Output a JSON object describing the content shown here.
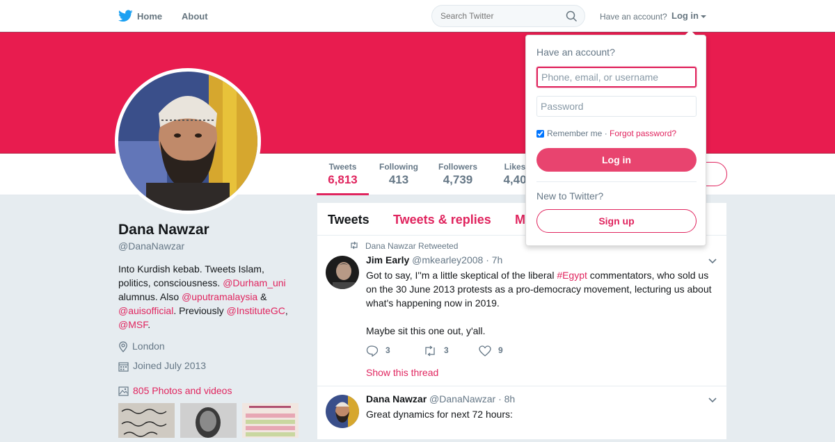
{
  "topbar": {
    "home": "Home",
    "about": "About",
    "search_placeholder": "Search Twitter",
    "have_account": "Have an account?",
    "login": "Log in"
  },
  "colors": {
    "accent": "#e0245e",
    "banner": "#e81c4f",
    "bird": "#1da1f2"
  },
  "stats": [
    {
      "label": "Tweets",
      "value": "6,813"
    },
    {
      "label": "Following",
      "value": "413"
    },
    {
      "label": "Followers",
      "value": "4,739"
    },
    {
      "label": "Likes",
      "value": "4,40"
    }
  ],
  "profile": {
    "name": "Dana Nawzar",
    "handle": "@DanaNawzar",
    "bio": {
      "t1": "Into Kurdish kebab. Tweets Islam, politics, consciousness. ",
      "m1": "@Durham_uni",
      "t2": " alumnus. Also ",
      "m2": "@uputramalaysia",
      "t3": " & ",
      "m3": "@auisofficial",
      "t4": ". Previously ",
      "m4": "@InstituteGC",
      "t5": ", ",
      "m5": "@MSF",
      "t6": "."
    },
    "location": "London",
    "joined": "Joined July 2013",
    "photos": "805 Photos and videos"
  },
  "tabs": [
    "Tweets",
    "Tweets & replies",
    "M"
  ],
  "tweets": [
    {
      "retweeted_by": "Dana Nawzar Retweeted",
      "name": "Jim Early",
      "handle": "@mkearley2008",
      "time": "· 7h",
      "text_a": "Got to say, I''m a little skeptical of the liberal ",
      "hashtag": "#Egypt",
      "text_b": " commentators, who sold us on the 30 June 2013 protests as a pro-democracy movement, lecturing us about what's happening now in 2019.",
      "text_c": "Maybe sit this one out, y'all.",
      "replies": "3",
      "retweets": "3",
      "likes": "9",
      "thread": "Show this thread"
    },
    {
      "name": "Dana Nawzar",
      "handle": "@DanaNawzar",
      "time": "· 8h",
      "text": "Great dynamics for next 72 hours:"
    }
  ],
  "login_dropdown": {
    "title": "Have an account?",
    "username_placeholder": "Phone, email, or username",
    "password_placeholder": "Password",
    "remember": "Remember me",
    "separator": " · ",
    "forgot": "Forgot password?",
    "login_button": "Log in",
    "new_to_twitter": "New to Twitter?",
    "signup_button": "Sign up"
  }
}
